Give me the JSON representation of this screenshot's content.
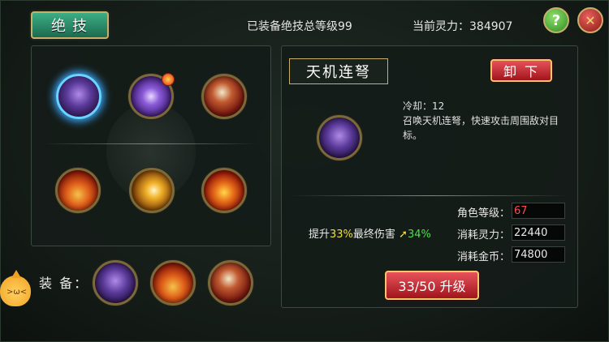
{
  "header": {
    "tab_label": "绝技",
    "equipped_total": "已装备绝技总等级99",
    "current_power": "当前灵力：384907",
    "help_label": "?",
    "close_label": "✕"
  },
  "skill_grid": {
    "row1": [
      {
        "icon": "crossbow-skill-icon",
        "selected": true
      },
      {
        "icon": "taiji-skill-icon",
        "has_alert": true
      },
      {
        "icon": "claw-skill-icon"
      }
    ],
    "row2": [
      {
        "icon": "fire-skill-icon"
      },
      {
        "icon": "slash-skill-icon"
      },
      {
        "icon": "light-slash-skill-icon"
      }
    ]
  },
  "equip": {
    "label": "装 备：",
    "slots": [
      "crossbow-skill-icon",
      "fire-skill-icon",
      "claw-skill-icon"
    ]
  },
  "detail": {
    "name": "天机连弩",
    "unload_label": "卸下",
    "cooldown": "冷却：12",
    "desc_line1": "召唤天机连弩，快速攻击周围敌对目",
    "desc_line2": "标。",
    "boost_prefix": "提升",
    "boost_value": "33%",
    "boost_suffix": "最终伤害",
    "boost_next": "34%",
    "stats": {
      "role_level_label": "角色等级：",
      "role_level_value": "67",
      "power_cost_label": "消耗灵力：",
      "power_cost_value": "22440",
      "gold_cost_label": "消耗金币：",
      "gold_cost_value": "74800"
    },
    "upgrade_label": "33/50 升级"
  },
  "colors": {
    "accent_gold": "#c9b06a",
    "boost_yellow": "#f0e040",
    "boost_green": "#4ae04a",
    "level_red": "#ff4a4a"
  }
}
